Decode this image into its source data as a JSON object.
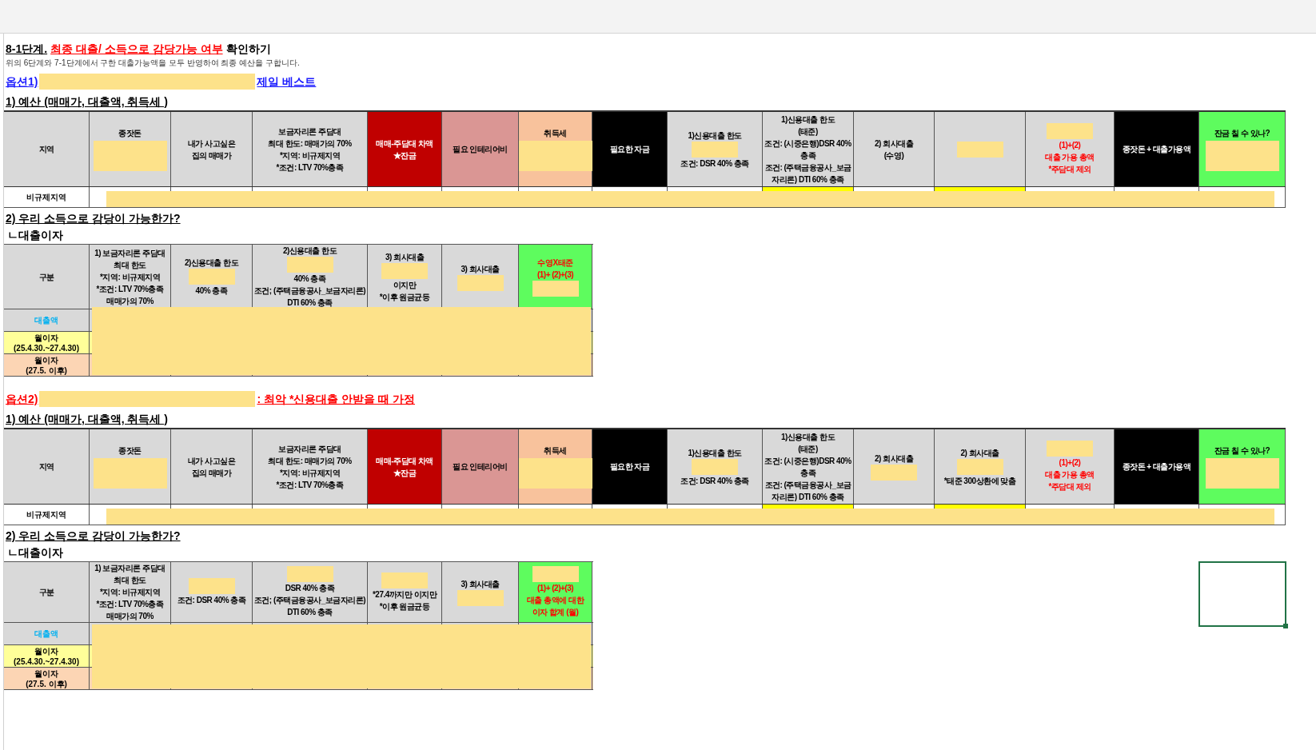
{
  "title": [
    {
      "text": "8-1단계.",
      "emphasis": false,
      "underline": true
    },
    {
      "text": "최종 대출/ 소득으로 감당가능 여부",
      "emphasis": true,
      "underline": true
    },
    {
      "text": "확인하기",
      "emphasis": false,
      "underline": false
    }
  ],
  "subtitle": "위의 6단계와 7-1단계에서 구한 대출가능액을 모두 반영하여 최종 예산을 구합니다.",
  "sections": [
    {
      "option": {
        "warning": false,
        "parts": [
          {
            "kind": "text",
            "text": "옵션1)"
          },
          {
            "kind": "mask"
          },
          {
            "kind": "text",
            "text": "제일 베스트"
          }
        ]
      },
      "budget": {
        "heading": "1) 예산 (매매가, 대출액, 취득세 )",
        "columns": [
          {
            "color": "#d9d9d9",
            "alert": false,
            "highlighted": false,
            "lines": [
              {
                "kind": "text",
                "text": "지역"
              }
            ]
          },
          {
            "color": "#d9d9d9",
            "alert": false,
            "highlighted": false,
            "lines": [
              {
                "kind": "text",
                "text": "종잣돈"
              },
              {
                "kind": "block"
              }
            ]
          },
          {
            "color": "#d9d9d9",
            "alert": false,
            "highlighted": false,
            "lines": [
              {
                "kind": "text",
                "text": "내가 사고싶은"
              },
              {
                "kind": "text",
                "text": "집의 매매가"
              }
            ]
          },
          {
            "color": "#d9d9d9",
            "alert": false,
            "highlighted": false,
            "lines": [
              {
                "kind": "text",
                "text": "보금자리론 주담대"
              },
              {
                "kind": "text",
                "text": "최대 한도: 매매가의 70%"
              },
              {
                "kind": "text",
                "text": "*지역: 비규제지역"
              },
              {
                "kind": "text",
                "text": "*조건: LTV 70%충족"
              }
            ]
          },
          {
            "color": "#c00000",
            "alert": false,
            "highlighted": false,
            "lines": [
              {
                "kind": "text",
                "text": "매매-주담대 차액"
              },
              {
                "kind": "text",
                "text": "★잔금"
              }
            ]
          },
          {
            "color": "#da9694",
            "alert": false,
            "highlighted": false,
            "lines": [
              {
                "kind": "text",
                "text": "필요 인테리어비"
              }
            ]
          },
          {
            "color": "#f8c29c",
            "alert": false,
            "highlighted": false,
            "lines": [
              {
                "kind": "text",
                "text": "취득세"
              },
              {
                "kind": "block"
              }
            ]
          },
          {
            "color": "#000000",
            "alert": false,
            "highlighted": false,
            "lines": [
              {
                "kind": "text",
                "text": "필요한 자금"
              }
            ]
          },
          {
            "color": "#d9d9d9",
            "alert": false,
            "highlighted": false,
            "lines": [
              {
                "kind": "text",
                "text": "1)신용대출 한도"
              },
              {
                "kind": "mask"
              },
              {
                "kind": "text",
                "text": "조건: DSR 40% 충족"
              }
            ]
          },
          {
            "color": "#d9d9d9",
            "alert": false,
            "highlighted": true,
            "lines": [
              {
                "kind": "text",
                "text": "1)신용대출 한도"
              },
              {
                "kind": "text",
                "text": "(태준)"
              },
              {
                "kind": "text",
                "text": "조건: (시중은행)DSR 40%"
              },
              {
                "kind": "text",
                "text": "충족"
              },
              {
                "kind": "text",
                "text": "조건: (주택금융공사_보금"
              },
              {
                "kind": "text",
                "text": "자리론) DTI 60% 충족"
              }
            ]
          },
          {
            "color": "#d9d9d9",
            "alert": false,
            "highlighted": false,
            "lines": [
              {
                "kind": "text",
                "text": "2) 회사대출"
              },
              {
                "kind": "text",
                "text": "(수영)"
              }
            ]
          },
          {
            "color": "#d9d9d9",
            "alert": false,
            "highlighted": true,
            "lines": [
              {
                "kind": "mask"
              }
            ]
          },
          {
            "color": "#d9d9d9",
            "alert": true,
            "highlighted": false,
            "lines": [
              {
                "kind": "mask"
              },
              {
                "kind": "text",
                "text": "(1)+(2)"
              },
              {
                "kind": "text",
                "text": "대출 가용 총액"
              },
              {
                "kind": "text",
                "text": "*주담대 제외"
              }
            ]
          },
          {
            "color": "#000000",
            "alert": false,
            "highlighted": false,
            "lines": [
              {
                "kind": "text",
                "text": "종잣돈 + 대출가용액"
              }
            ]
          },
          {
            "color": "#5efc5e",
            "alert": false,
            "highlighted": false,
            "lines": [
              {
                "kind": "text",
                "text": "잔금 칠 수 있나?"
              },
              {
                "kind": "block"
              }
            ]
          }
        ],
        "rows": [
          {
            "label": "비규제지역",
            "masked": true
          }
        ]
      },
      "affordability": {
        "heading": "2) 우리 소득으로 감당이 가능한가?",
        "subheading": "ㄴ대출이자",
        "cell_cursor": false,
        "masked": true,
        "columns": [
          {
            "color": "#d9d9d9",
            "alert": false,
            "lines": [
              {
                "kind": "text",
                "text": "구분"
              }
            ]
          },
          {
            "color": "#d9d9d9",
            "alert": false,
            "lines": [
              {
                "kind": "text",
                "text": "1) 보금자리론 주담대"
              },
              {
                "kind": "text",
                "text": "최대 한도"
              },
              {
                "kind": "text",
                "text": "*지역: 비규제지역"
              },
              {
                "kind": "text",
                "text": "*조건: LTV 70%충족"
              },
              {
                "kind": "text",
                "text": "매매가의 70%"
              }
            ]
          },
          {
            "color": "#d9d9d9",
            "alert": false,
            "lines": [
              {
                "kind": "text",
                "text": "2)신용대출 한도"
              },
              {
                "kind": "mask"
              },
              {
                "kind": "text",
                "text": "40% 충족"
              }
            ]
          },
          {
            "color": "#d9d9d9",
            "alert": false,
            "lines": [
              {
                "kind": "text",
                "text": "2)신용대출 한도"
              },
              {
                "kind": "mask"
              },
              {
                "kind": "text",
                "text": "40% 충족"
              },
              {
                "kind": "text",
                "text": "조건; (주택금융공사_보금자리론)"
              },
              {
                "kind": "text",
                "text": "DTI 60% 충족"
              }
            ]
          },
          {
            "color": "#d9d9d9",
            "alert": false,
            "lines": [
              {
                "kind": "text",
                "text": "3) 회사대출"
              },
              {
                "kind": "mask"
              },
              {
                "kind": "text",
                "text": "이지만"
              },
              {
                "kind": "text",
                "text": "*이후 원금균등"
              }
            ]
          },
          {
            "color": "#d9d9d9",
            "alert": false,
            "lines": [
              {
                "kind": "text",
                "text": "3) 회사대출"
              },
              {
                "kind": "mask"
              }
            ]
          },
          {
            "color": "#5efc5e",
            "alert": true,
            "lines": [
              {
                "kind": "text",
                "text": "수영X태준"
              },
              {
                "kind": "text",
                "text": "(1)+ (2)+(3)"
              },
              {
                "kind": "mask"
              }
            ]
          }
        ],
        "rows": [
          {
            "color": "#d9d9d9",
            "accent": true,
            "label": [
              "대출액"
            ]
          },
          {
            "color": "#ffff99",
            "accent": false,
            "label": [
              "월이자",
              "(25.4.30.~27.4.30)"
            ]
          },
          {
            "color": "#fcd5b4",
            "accent": false,
            "label": [
              "월이자",
              "(27.5. 이후)"
            ]
          }
        ]
      }
    },
    {
      "option": {
        "warning": true,
        "parts": [
          {
            "kind": "text",
            "text": "옵션2)"
          },
          {
            "kind": "mask"
          },
          {
            "kind": "text",
            "text": ": 최악 *신용대출 안받을 때 가정"
          }
        ]
      },
      "budget": {
        "heading": "1) 예산 (매매가, 대출액, 취득세 )",
        "columns": [
          {
            "color": "#d9d9d9",
            "alert": false,
            "highlighted": false,
            "lines": [
              {
                "kind": "text",
                "text": "지역"
              }
            ]
          },
          {
            "color": "#d9d9d9",
            "alert": false,
            "highlighted": false,
            "lines": [
              {
                "kind": "text",
                "text": "종잣돈"
              },
              {
                "kind": "block"
              }
            ]
          },
          {
            "color": "#d9d9d9",
            "alert": false,
            "highlighted": false,
            "lines": [
              {
                "kind": "text",
                "text": "내가 사고싶은"
              },
              {
                "kind": "text",
                "text": "집의 매매가"
              }
            ]
          },
          {
            "color": "#d9d9d9",
            "alert": false,
            "highlighted": false,
            "lines": [
              {
                "kind": "text",
                "text": "보금자리론 주담대"
              },
              {
                "kind": "text",
                "text": "최대 한도: 매매가의 70%"
              },
              {
                "kind": "text",
                "text": "*지역: 비규제지역"
              },
              {
                "kind": "text",
                "text": "*조건: LTV 70%충족"
              }
            ]
          },
          {
            "color": "#c00000",
            "alert": false,
            "highlighted": false,
            "lines": [
              {
                "kind": "text",
                "text": "매매-주담대 차액"
              },
              {
                "kind": "text",
                "text": "★잔금"
              }
            ]
          },
          {
            "color": "#da9694",
            "alert": false,
            "highlighted": false,
            "lines": [
              {
                "kind": "text",
                "text": "필요 인테리어비"
              }
            ]
          },
          {
            "color": "#f8c29c",
            "alert": false,
            "highlighted": false,
            "lines": [
              {
                "kind": "text",
                "text": "취득세"
              },
              {
                "kind": "block"
              }
            ]
          },
          {
            "color": "#000000",
            "alert": false,
            "highlighted": false,
            "lines": [
              {
                "kind": "text",
                "text": "필요한 자금"
              }
            ]
          },
          {
            "color": "#d9d9d9",
            "alert": false,
            "highlighted": false,
            "lines": [
              {
                "kind": "text",
                "text": "1)신용대출 한도"
              },
              {
                "kind": "mask"
              },
              {
                "kind": "text",
                "text": "조건: DSR 40% 충족"
              }
            ]
          },
          {
            "color": "#d9d9d9",
            "alert": false,
            "highlighted": true,
            "lines": [
              {
                "kind": "text",
                "text": "1)신용대출 한도"
              },
              {
                "kind": "text",
                "text": "(태준)"
              },
              {
                "kind": "text",
                "text": "조건: (시중은행)DSR 40%"
              },
              {
                "kind": "text",
                "text": "충족"
              },
              {
                "kind": "text",
                "text": "조건: (주택금융공사_보금"
              },
              {
                "kind": "text",
                "text": "자리론) DTI 60% 충족"
              }
            ]
          },
          {
            "color": "#d9d9d9",
            "alert": false,
            "highlighted": false,
            "lines": [
              {
                "kind": "text",
                "text": "2) 회사대출"
              },
              {
                "kind": "mask"
              }
            ]
          },
          {
            "color": "#d9d9d9",
            "alert": false,
            "highlighted": true,
            "lines": [
              {
                "kind": "text",
                "text": "2) 회사대출"
              },
              {
                "kind": "mask"
              },
              {
                "kind": "text",
                "text": "*태준 300상환에 맞춤"
              }
            ]
          },
          {
            "color": "#d9d9d9",
            "alert": true,
            "highlighted": false,
            "lines": [
              {
                "kind": "mask"
              },
              {
                "kind": "text",
                "text": "(1)+(2)"
              },
              {
                "kind": "text",
                "text": "대출 가용 총액"
              },
              {
                "kind": "text",
                "text": "*주담대 제외"
              }
            ]
          },
          {
            "color": "#000000",
            "alert": false,
            "highlighted": false,
            "lines": [
              {
                "kind": "text",
                "text": "종잣돈 + 대출가용액"
              }
            ]
          },
          {
            "color": "#5efc5e",
            "alert": false,
            "highlighted": false,
            "lines": [
              {
                "kind": "text",
                "text": "잔금 칠 수 있나?"
              },
              {
                "kind": "block"
              }
            ]
          }
        ],
        "rows": [
          {
            "label": "비규제지역",
            "masked": true
          }
        ]
      },
      "affordability": {
        "heading": "2) 우리 소득으로 감당이 가능한가?",
        "subheading": "ㄴ대출이자",
        "cell_cursor": true,
        "masked": true,
        "columns": [
          {
            "color": "#d9d9d9",
            "alert": false,
            "lines": [
              {
                "kind": "text",
                "text": "구분"
              }
            ]
          },
          {
            "color": "#d9d9d9",
            "alert": false,
            "lines": [
              {
                "kind": "text",
                "text": "1) 보금자리론 주담대"
              },
              {
                "kind": "text",
                "text": "최대 한도"
              },
              {
                "kind": "text",
                "text": "*지역: 비규제지역"
              },
              {
                "kind": "text",
                "text": "*조건: LTV 70%충족"
              },
              {
                "kind": "text",
                "text": "매매가의 70%"
              }
            ]
          },
          {
            "color": "#d9d9d9",
            "alert": false,
            "lines": [
              {
                "kind": "mask"
              },
              {
                "kind": "text",
                "text": "조건: DSR 40% 충족"
              }
            ]
          },
          {
            "color": "#d9d9d9",
            "alert": false,
            "lines": [
              {
                "kind": "mask"
              },
              {
                "kind": "text",
                "text": "DSR 40% 충족"
              },
              {
                "kind": "text",
                "text": "조건; (주택금융공사_보금자리론)"
              },
              {
                "kind": "text",
                "text": "DTI 60% 충족"
              }
            ]
          },
          {
            "color": "#d9d9d9",
            "alert": false,
            "lines": [
              {
                "kind": "mask"
              },
              {
                "kind": "text",
                "text": "*27.4까지만 이지만"
              },
              {
                "kind": "text",
                "text": "*이후 원금균등"
              }
            ]
          },
          {
            "color": "#d9d9d9",
            "alert": false,
            "lines": [
              {
                "kind": "text",
                "text": "3) 회사대출"
              },
              {
                "kind": "mask"
              }
            ]
          },
          {
            "color": "#5efc5e",
            "alert": true,
            "lines": [
              {
                "kind": "mask"
              },
              {
                "kind": "text",
                "text": "(1)+ (2)+(3)"
              },
              {
                "kind": "text",
                "text": "대출 총액에 대한"
              },
              {
                "kind": "text",
                "text": "이자 합계 (월)"
              }
            ]
          }
        ],
        "rows": [
          {
            "color": "#d9d9d9",
            "accent": true,
            "label": [
              "대출액"
            ]
          },
          {
            "color": "#ffff99",
            "accent": false,
            "label": [
              "월이자",
              "(25.4.30.~27.4.30)"
            ]
          },
          {
            "color": "#fcd5b4",
            "accent": false,
            "label": [
              "월이자",
              "(27.5. 이후)"
            ]
          }
        ]
      }
    }
  ]
}
